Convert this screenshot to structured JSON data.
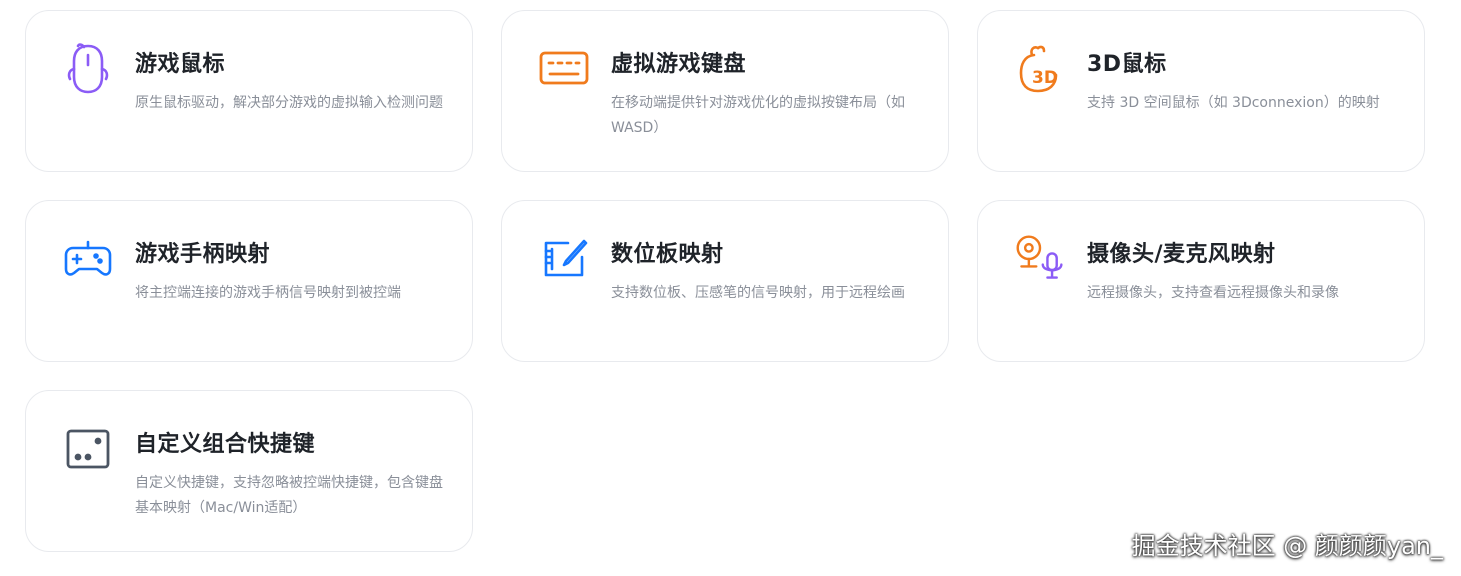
{
  "cards": [
    {
      "title": "游戏鼠标",
      "desc": "原生鼠标驱动，解决部分游戏的虚拟输入检测问题",
      "icon": "gaming-mouse-icon",
      "color": "#8b5cf6"
    },
    {
      "title": "虚拟游戏键盘",
      "desc": "在移动端提供针对游戏优化的虚拟按键布局（如WASD）",
      "icon": "keyboard-icon",
      "color": "#f07b1d"
    },
    {
      "title": "3D鼠标",
      "desc": "支持 3D 空间鼠标（如 3Dconnexion）的映射",
      "icon": "3d-mouse-icon",
      "color": "#f07b1d"
    },
    {
      "title": "游戏手柄映射",
      "desc": "将主控端连接的游戏手柄信号映射到被控端",
      "icon": "gamepad-icon",
      "color": "#1677ff"
    },
    {
      "title": "数位板映射",
      "desc": "支持数位板、压感笔的信号映射，用于远程绘画",
      "icon": "drawing-tablet-icon",
      "color": "#1677ff"
    },
    {
      "title": "摄像头/麦克风映射",
      "desc": "远程摄像头，支持查看远程摄像头和录像",
      "icon": "camera-microphone-icon",
      "color": "#f07b1d",
      "color2": "#8b5cf6"
    },
    {
      "title": "自定义组合快捷键",
      "desc": "自定义快捷键，支持忽略被控端快捷键，包含键盘基本映射（Mac/Win适配）",
      "icon": "shortcut-keys-icon",
      "color": "#4b5563"
    }
  ],
  "watermark": "掘金技术社区 @ 颜颜颜yan_"
}
